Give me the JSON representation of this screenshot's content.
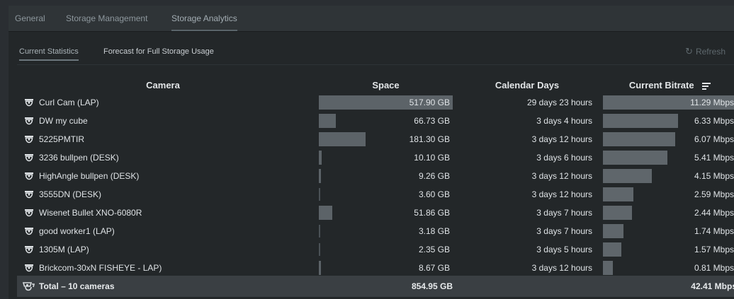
{
  "tabs": [
    "General",
    "Storage Management",
    "Storage Analytics"
  ],
  "sub_tabs": [
    "Current Statistics",
    "Forecast for Full Storage Usage"
  ],
  "refresh_label": "Refresh",
  "table": {
    "headers": {
      "camera": "Camera",
      "space": "Space",
      "days": "Calendar Days",
      "bitrate": "Current Bitrate"
    },
    "rows": [
      {
        "camera": "Curl Cam (LAP)",
        "space": "517.90 GB",
        "space_gb": 517.9,
        "days": "29 days 23 hours",
        "bitrate": "11.29 Mbps",
        "bitrate_mbps": 11.29
      },
      {
        "camera": "DW my cube",
        "space": "66.73 GB",
        "space_gb": 66.73,
        "days": "3 days 4 hours",
        "bitrate": "6.33 Mbps",
        "bitrate_mbps": 6.33
      },
      {
        "camera": "5225PMTIR",
        "space": "181.30 GB",
        "space_gb": 181.3,
        "days": "3 days 12 hours",
        "bitrate": "6.07 Mbps",
        "bitrate_mbps": 6.07
      },
      {
        "camera": "3236 bullpen (DESK)",
        "space": "10.10 GB",
        "space_gb": 10.1,
        "days": "3 days 6 hours",
        "bitrate": "5.41 Mbps",
        "bitrate_mbps": 5.41
      },
      {
        "camera": "HighAngle bullpen (DESK)",
        "space": "9.26 GB",
        "space_gb": 9.26,
        "days": "3 days 12 hours",
        "bitrate": "4.15 Mbps",
        "bitrate_mbps": 4.15
      },
      {
        "camera": "3555DN (DESK)",
        "space": "3.60 GB",
        "space_gb": 3.6,
        "days": "3 days 12 hours",
        "bitrate": "2.59 Mbps",
        "bitrate_mbps": 2.59
      },
      {
        "camera": "Wisenet Bullet XNO-6080R",
        "space": "51.86 GB",
        "space_gb": 51.86,
        "days": "3 days 7 hours",
        "bitrate": "2.44 Mbps",
        "bitrate_mbps": 2.44
      },
      {
        "camera": "good worker1 (LAP)",
        "space": "3.18 GB",
        "space_gb": 3.18,
        "days": "3 days 7 hours",
        "bitrate": "1.74 Mbps",
        "bitrate_mbps": 1.74
      },
      {
        "camera": "1305M (LAP)",
        "space": "2.35 GB",
        "space_gb": 2.35,
        "days": "3 days 5 hours",
        "bitrate": "1.57 Mbps",
        "bitrate_mbps": 1.57
      },
      {
        "camera": "Brickcom-30xN FISHEYE - LAP)",
        "space": "8.67 GB",
        "space_gb": 8.67,
        "days": "3 days 12 hours",
        "bitrate": "0.81 Mbps",
        "bitrate_mbps": 0.81
      }
    ],
    "total": {
      "label": "Total – 10 cameras",
      "space": "854.95 GB",
      "bitrate": "42.41 Mbps"
    }
  },
  "colors": {
    "background": "#232729",
    "bar": "#5c6368",
    "total_row": "#3a3f43"
  },
  "icons": {
    "camera": "camera-icon",
    "total": "cameras-icon",
    "refresh": "refresh-icon",
    "sort": "sort-descending-icon"
  }
}
